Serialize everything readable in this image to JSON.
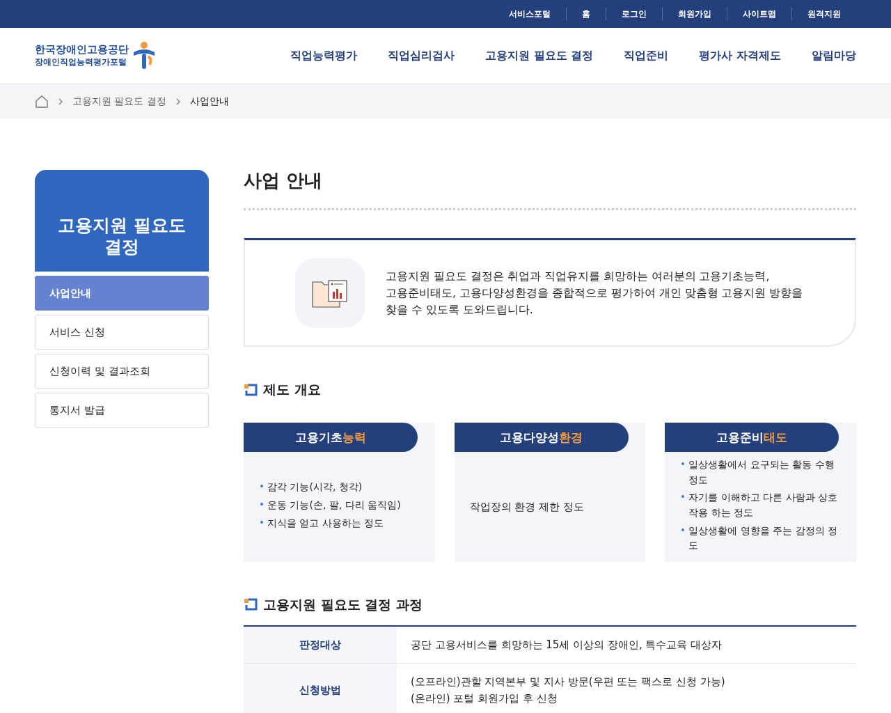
{
  "utility_links": [
    "서비스포털",
    "홈",
    "로그인",
    "회원가입",
    "사이트맵",
    "원격지원"
  ],
  "logo": {
    "line1": "한국장애인고용공단",
    "line2": "장애인직업능력평가포털"
  },
  "main_nav": [
    "직업능력평가",
    "직업심리검사",
    "고용지원 필요도 결정",
    "직업준비",
    "평가사 자격제도",
    "알림마당"
  ],
  "breadcrumb": [
    "고용지원 필요도 결정",
    "사업안내"
  ],
  "sidebar": {
    "title": "고용지원 필요도 결정",
    "items": [
      {
        "label": "사업안내",
        "selected": true
      },
      {
        "label": "서비스 신청",
        "selected": false
      },
      {
        "label": "신청이력 및 결과조회",
        "selected": false
      },
      {
        "label": "통지서 발급",
        "selected": false
      }
    ]
  },
  "page_title": "사업 안내",
  "intro": "고용지원 필요도 결정은 취업과 직업유지를 희망하는 여러분의 고용기초능력,\n고용준비태도, 고용다양성환경을 종합적으로 평가하여 개인 맞춤형 고용지원 방향을\n찾을 수 있도록 도와드립니다.",
  "section_overview": {
    "heading": "제도 개요",
    "cards": [
      {
        "title": "고용기초",
        "title_highlight": "능력",
        "kind": "list",
        "items": [
          "감각 기능(시각, 청각)",
          "운동 기능(손, 팔, 다리 움직임)",
          "지식을 얻고 사용하는 정도"
        ]
      },
      {
        "title": "고용다양성",
        "title_highlight": "환경",
        "kind": "text",
        "items": [
          "작업장의 환경 제한 정도"
        ]
      },
      {
        "title": "고용준비",
        "title_highlight": "태도",
        "kind": "list",
        "items": [
          "일상생활에서 요구되는 활동 수행 정도",
          "자기를 이해하고 다른 사람과 상호 작용 하는 정도",
          "일상생활에 영향을 주는 감정의 정도"
        ]
      }
    ]
  },
  "section_process": {
    "heading": "고용지원 필요도 결정 과정",
    "rows": [
      {
        "label": "판정대상",
        "lines": [
          "공단 고용서비스를 희망하는 15세 이상의 장애인, 특수교육 대상자"
        ]
      },
      {
        "label": "신청방법",
        "lines": [
          "(오프라인)관할 지역본부 및 지사 방문(우편 또는 팩스로 신청 가능)",
          "(온라인) 포털 회원가입 후 신청"
        ]
      }
    ]
  }
}
